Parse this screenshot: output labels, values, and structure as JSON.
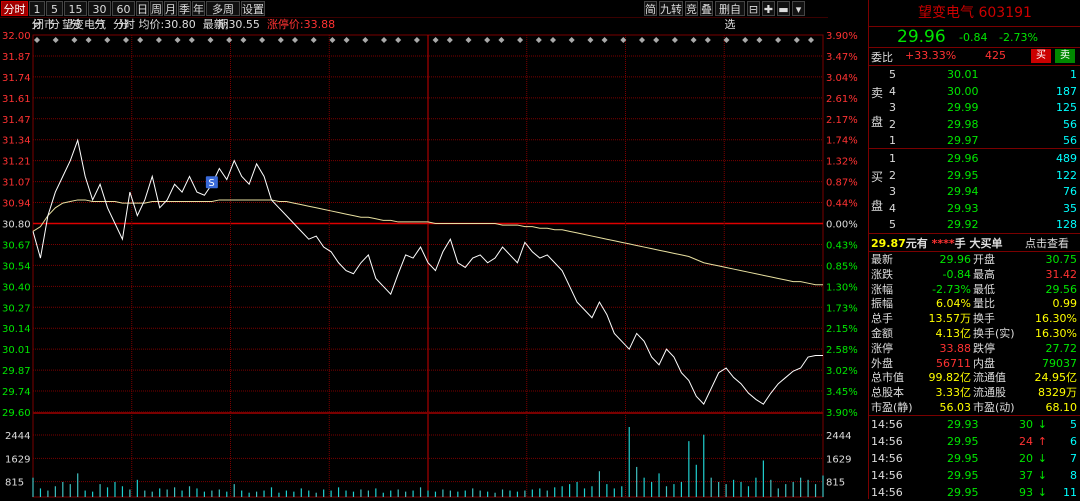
{
  "toolbar": {
    "tabs": [
      "分时",
      "1分",
      "5分",
      "15分",
      "30分",
      "60分",
      "日",
      "周",
      "月",
      "季",
      "年",
      "多周期",
      "设置"
    ],
    "right_buttons": [
      "简",
      "九转",
      "竞",
      "叠",
      "删自选",
      "⊟",
      "✚",
      "▬",
      "▾"
    ]
  },
  "info": {
    "status": "闭市",
    "name": "望变电气",
    "mode": "分时",
    "avg_label": "均价:",
    "avg_value": "30.80",
    "last_label": "最新:",
    "last_value": "30.55",
    "limit_label": "涨停价:",
    "limit_value": "33.88"
  },
  "chart_data": {
    "type": "line",
    "y_price_ticks": [
      "32.00",
      "31.87",
      "31.74",
      "31.61",
      "31.47",
      "31.34",
      "31.21",
      "31.07",
      "30.94",
      "30.80",
      "30.67",
      "30.54",
      "30.40",
      "30.27",
      "30.14",
      "30.01",
      "29.87",
      "29.74",
      "29.60"
    ],
    "y_pct_ticks": [
      "3.90%",
      "3.47%",
      "3.04%",
      "2.61%",
      "2.17%",
      "1.74%",
      "1.32%",
      "0.87%",
      "0.44%",
      "0.00%",
      "0.43%",
      "0.85%",
      "1.30%",
      "1.73%",
      "2.15%",
      "2.58%",
      "3.02%",
      "3.45%",
      "3.90%"
    ],
    "ylim": [
      29.6,
      32.0
    ],
    "prev_close": 30.8,
    "price": [
      30.75,
      30.58,
      30.85,
      31.0,
      31.1,
      31.2,
      31.33,
      31.1,
      30.95,
      31.05,
      30.9,
      30.8,
      30.7,
      31.0,
      30.85,
      30.95,
      31.1,
      30.9,
      30.95,
      31.05,
      31.0,
      31.1,
      31.0,
      30.98,
      31.05,
      31.15,
      31.08,
      31.2,
      31.1,
      31.05,
      31.18,
      31.1,
      30.95,
      30.9,
      30.85,
      30.8,
      30.75,
      30.7,
      30.72,
      30.65,
      30.62,
      30.55,
      30.5,
      30.48,
      30.55,
      30.6,
      30.45,
      30.4,
      30.35,
      30.48,
      30.6,
      30.58,
      30.65,
      30.55,
      30.5,
      30.62,
      30.7,
      30.55,
      30.52,
      30.58,
      30.6,
      30.55,
      30.58,
      30.65,
      30.6,
      30.55,
      30.68,
      30.62,
      30.58,
      30.6,
      30.55,
      30.5,
      30.4,
      30.3,
      30.25,
      30.2,
      30.3,
      30.22,
      30.1,
      30.05,
      30.0,
      30.1,
      30.05,
      29.95,
      29.9,
      30.0,
      29.95,
      29.85,
      29.8,
      29.7,
      29.65,
      29.75,
      29.85,
      29.88,
      29.82,
      29.78,
      29.72,
      29.68,
      29.65,
      29.72,
      29.78,
      29.82,
      29.86,
      29.88,
      29.95,
      29.96,
      29.96
    ],
    "avg": [
      30.75,
      30.78,
      30.85,
      30.9,
      30.93,
      30.94,
      30.95,
      30.95,
      30.94,
      30.94,
      30.94,
      30.94,
      30.93,
      30.93,
      30.93,
      30.93,
      30.94,
      30.94,
      30.94,
      30.94,
      30.94,
      30.94,
      30.94,
      30.94,
      30.94,
      30.95,
      30.95,
      30.95,
      30.95,
      30.95,
      30.95,
      30.95,
      30.95,
      30.94,
      30.94,
      30.93,
      30.92,
      30.91,
      30.9,
      30.89,
      30.88,
      30.87,
      30.86,
      30.85,
      30.84,
      30.84,
      30.83,
      30.82,
      30.82,
      30.81,
      30.81,
      30.81,
      30.81,
      30.81,
      30.8,
      30.8,
      30.8,
      30.8,
      30.8,
      30.8,
      30.8,
      30.8,
      30.8,
      30.79,
      30.79,
      30.79,
      30.78,
      30.78,
      30.77,
      30.77,
      30.76,
      30.76,
      30.75,
      30.74,
      30.73,
      30.72,
      30.71,
      30.7,
      30.69,
      30.68,
      30.67,
      30.66,
      30.65,
      30.64,
      30.63,
      30.62,
      30.61,
      30.6,
      30.59,
      30.57,
      30.55,
      30.54,
      30.53,
      30.52,
      30.51,
      30.5,
      30.49,
      30.48,
      30.47,
      30.46,
      30.45,
      30.44,
      30.43,
      30.43,
      30.42,
      30.41,
      30.41
    ],
    "volume_ticks": [
      "2444",
      "1629",
      "815"
    ],
    "volume_max": 3259,
    "volume": [
      900,
      400,
      300,
      500,
      700,
      600,
      1100,
      300,
      250,
      600,
      450,
      700,
      500,
      350,
      800,
      300,
      250,
      400,
      350,
      450,
      300,
      500,
      400,
      250,
      300,
      350,
      250,
      600,
      300,
      200,
      250,
      300,
      450,
      200,
      300,
      250,
      400,
      300,
      200,
      350,
      300,
      450,
      300,
      250,
      350,
      300,
      400,
      200,
      300,
      350,
      250,
      300,
      450,
      300,
      250,
      350,
      300,
      250,
      300,
      400,
      300,
      250,
      200,
      350,
      300,
      250,
      300,
      350,
      400,
      300,
      450,
      500,
      600,
      700,
      400,
      500,
      1200,
      600,
      400,
      500,
      3259,
      1400,
      900,
      700,
      1100,
      500,
      600,
      700,
      2600,
      1500,
      2900,
      900,
      700,
      600,
      800,
      700,
      500,
      900,
      1700,
      800,
      400,
      600,
      700,
      900,
      800,
      600,
      1000
    ],
    "signal_marker": "S"
  },
  "panel": {
    "title": "望变电气 603191",
    "price": "29.96",
    "change": "-0.84",
    "change_pct": "-2.73%",
    "wb_label": "委比",
    "wb_value": "+33.33%",
    "wc_value": "425",
    "buy_btn": "买",
    "sell_btn": "卖",
    "sell_side": [
      "卖",
      "盘"
    ],
    "buy_side": [
      "买",
      "盘"
    ],
    "asks": [
      {
        "level": "5",
        "price": "30.01",
        "vol": "1"
      },
      {
        "level": "4",
        "price": "30.00",
        "vol": "187"
      },
      {
        "level": "3",
        "price": "29.99",
        "vol": "125"
      },
      {
        "level": "2",
        "price": "29.98",
        "vol": "56"
      },
      {
        "level": "1",
        "price": "29.97",
        "vol": "56"
      }
    ],
    "bids": [
      {
        "level": "1",
        "price": "29.96",
        "vol": "489"
      },
      {
        "level": "2",
        "price": "29.95",
        "vol": "122"
      },
      {
        "level": "3",
        "price": "29.94",
        "vol": "76"
      },
      {
        "level": "4",
        "price": "29.93",
        "vol": "35"
      },
      {
        "level": "5",
        "price": "29.92",
        "vol": "128"
      }
    ],
    "bigorder": {
      "price": "29.87",
      "unit": "元有",
      "mask": "****",
      "hand": "手",
      "label": "大买单",
      "link": "点击查看"
    },
    "stats": [
      {
        "l1": "最新",
        "v1": "29.96",
        "c1": "grn",
        "l2": "开盘",
        "v2": "30.75",
        "c2": "grn"
      },
      {
        "l1": "涨跌",
        "v1": "-0.84",
        "c1": "grn",
        "l2": "最高",
        "v2": "31.42",
        "c2": "red"
      },
      {
        "l1": "涨幅",
        "v1": "-2.73%",
        "c1": "grn",
        "l2": "最低",
        "v2": "29.56",
        "c2": "grn"
      },
      {
        "l1": "振幅",
        "v1": "6.04%",
        "c1": "yel",
        "l2": "量比",
        "v2": "0.99",
        "c2": "yel"
      },
      {
        "l1": "总手",
        "v1": "13.57万",
        "c1": "yel",
        "l2": "换手",
        "v2": "16.30%",
        "c2": "yel"
      },
      {
        "l1": "金额",
        "v1": "4.13亿",
        "c1": "yel",
        "l2": "换手(实)",
        "v2": "16.30%",
        "c2": "yel"
      },
      {
        "l1": "涨停",
        "v1": "33.88",
        "c1": "red",
        "l2": "跌停",
        "v2": "27.72",
        "c2": "grn"
      },
      {
        "l1": "外盘",
        "v1": "56711",
        "c1": "red",
        "l2": "内盘",
        "v2": "79037",
        "c2": "grn"
      },
      {
        "l1": "总市值",
        "v1": "99.82亿",
        "c1": "yel",
        "l2": "流通值",
        "v2": "24.95亿",
        "c2": "yel"
      },
      {
        "l1": "总股本",
        "v1": "3.33亿",
        "c1": "yel",
        "l2": "流通股",
        "v2": "8329万",
        "c2": "yel"
      },
      {
        "l1": "市盈(静)",
        "v1": "56.03",
        "c1": "yel",
        "l2": "市盈(动)",
        "v2": "68.10",
        "c2": "yel"
      }
    ],
    "ticks": [
      {
        "time": "14:56",
        "price": "29.93",
        "pc": "grn",
        "vol": "30",
        "dir": "down",
        "num": "5"
      },
      {
        "time": "14:56",
        "price": "29.95",
        "pc": "grn",
        "vol": "24",
        "dir": "up",
        "num": "6"
      },
      {
        "time": "14:56",
        "price": "29.95",
        "pc": "grn",
        "vol": "20",
        "dir": "down",
        "num": "7"
      },
      {
        "time": "14:56",
        "price": "29.95",
        "pc": "grn",
        "vol": "37",
        "dir": "down",
        "num": "8"
      },
      {
        "time": "14:56",
        "price": "29.95",
        "pc": "grn",
        "vol": "93",
        "dir": "down",
        "num": "11"
      }
    ]
  },
  "colors": {
    "grid": "#7a0000",
    "price_line": "#ffffff",
    "avg_line": "#e8e0a0",
    "up": "#ff3232",
    "down": "#00e600",
    "bg": "#000000"
  }
}
